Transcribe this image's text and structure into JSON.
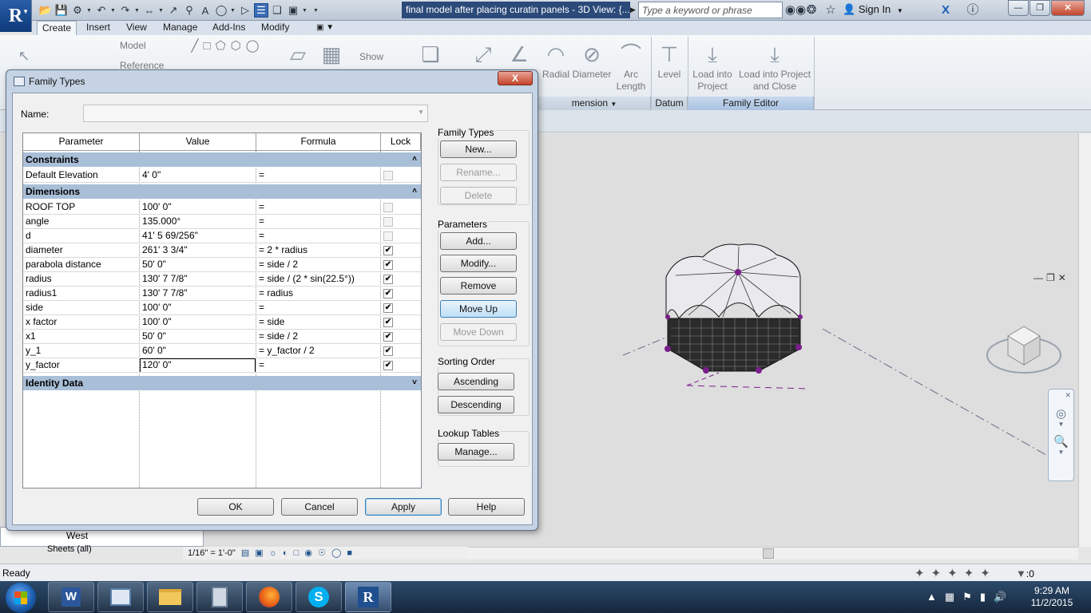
{
  "app": {
    "doc_title": "final model after placing curatin panels - 3D View: {...",
    "search_placeholder": "Type a keyword or phrase",
    "sign_in": "Sign In"
  },
  "ribbon": {
    "tabs": [
      "Create",
      "Insert",
      "View",
      "Manage",
      "Add-Ins",
      "Modify"
    ],
    "buttons": {
      "model": "Model",
      "reference": "Reference",
      "show": "Show",
      "radial": "Radial",
      "diameter": "Diameter",
      "arc_length": "Arc Length",
      "level": "Level",
      "load_project": "Load into Project",
      "load_close": "Load into Project and Close"
    },
    "panels": {
      "dimension": "mension",
      "datum": "Datum",
      "family_editor": "Family Editor"
    }
  },
  "view": {
    "scale": "1/16\" = 1'-0\"",
    "browser_item": "West",
    "browser_sheets": "Sheets (all)"
  },
  "status": {
    "text": "Ready",
    "filter_count": ":0"
  },
  "clock": {
    "time": "9:29 AM",
    "date": "11/2/2015"
  },
  "dialog": {
    "title": "Family Types",
    "close": "X",
    "name_label": "Name:",
    "name_value": "",
    "columns": [
      "Parameter",
      "Value",
      "Formula",
      "Lock"
    ],
    "groups": [
      {
        "name": "Constraints",
        "collapse_glyph": "˄",
        "rows": [
          {
            "name": "Default Elevation",
            "value": "4'  0\"",
            "formula": "=",
            "lock": false,
            "lock_enabled": false
          }
        ]
      },
      {
        "name": "Dimensions",
        "collapse_glyph": "˄",
        "rows": [
          {
            "name": "ROOF TOP",
            "value": "100'  0\"",
            "formula": "=",
            "lock": false,
            "lock_enabled": false
          },
          {
            "name": "angle",
            "value": "135.000°",
            "formula": "=",
            "lock": false,
            "lock_enabled": false
          },
          {
            "name": "d",
            "value": "41'  5 69/256\"",
            "formula": "=",
            "lock": false,
            "lock_enabled": false
          },
          {
            "name": "diameter",
            "value": "261'  3 3/4\"",
            "formula": "= 2 * radius",
            "lock": true,
            "lock_enabled": true
          },
          {
            "name": "parabola distance",
            "value": "50'  0\"",
            "formula": "= side / 2",
            "lock": true,
            "lock_enabled": true
          },
          {
            "name": "radius",
            "value": "130'  7 7/8\"",
            "formula": "= side / (2 * sin(22.5°))",
            "lock": true,
            "lock_enabled": true
          },
          {
            "name": "radius1",
            "value": "130'  7 7/8\"",
            "formula": "= radius",
            "lock": true,
            "lock_enabled": true
          },
          {
            "name": "side",
            "value": "100'  0\"",
            "formula": "=",
            "lock": true,
            "lock_enabled": true
          },
          {
            "name": "x factor",
            "value": "100'  0\"",
            "formula": "= side",
            "lock": true,
            "lock_enabled": true
          },
          {
            "name": "x1",
            "value": "50'  0\"",
            "formula": "= side / 2",
            "lock": true,
            "lock_enabled": true
          },
          {
            "name": "y_1",
            "value": "60'  0\"",
            "formula": "= y_factor / 2",
            "lock": true,
            "lock_enabled": true
          },
          {
            "name": "y_factor",
            "value": "120'  0\"",
            "formula": "=",
            "lock": true,
            "lock_enabled": true
          }
        ]
      },
      {
        "name": "Identity Data",
        "collapse_glyph": "˅",
        "rows": []
      }
    ],
    "family_types": {
      "label": "Family Types",
      "new": "New...",
      "rename": "Rename...",
      "delete": "Delete"
    },
    "parameters": {
      "label": "Parameters",
      "add": "Add...",
      "modify": "Modify...",
      "remove": "Remove",
      "move_up": "Move Up",
      "move_down": "Move Down"
    },
    "sorting": {
      "label": "Sorting Order",
      "ascending": "Ascending",
      "descending": "Descending"
    },
    "lookup": {
      "label": "Lookup Tables",
      "manage": "Manage..."
    },
    "footer": {
      "ok": "OK",
      "cancel": "Cancel",
      "apply": "Apply",
      "help": "Help"
    }
  }
}
